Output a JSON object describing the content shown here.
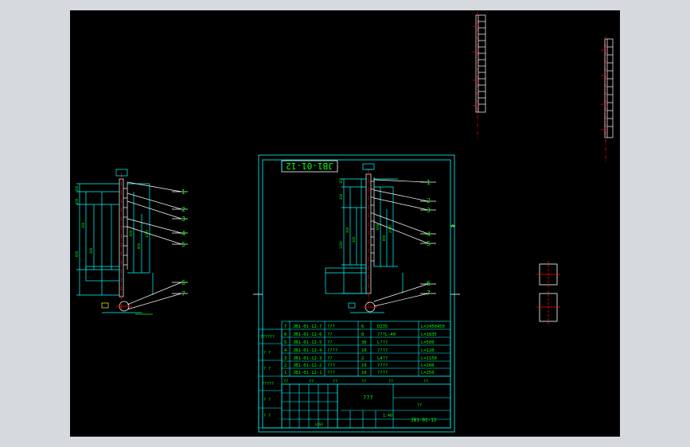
{
  "drawing": {
    "title_stamp": "JB1-01-12",
    "drawing_code": "JB1-01-12",
    "part_name": "???",
    "sheet_name": "??",
    "scale": "1:40",
    "company": "LOGO",
    "balloons_main": [
      "1",
      "2",
      "3",
      "4",
      "5",
      "6",
      "7"
    ],
    "balloons_left": [
      "1",
      "2",
      "3",
      "4",
      "5",
      "6",
      "7"
    ],
    "dims_main": [
      "160",
      "200",
      "300",
      "1200",
      "300",
      "600",
      "800",
      "2000"
    ],
    "dims_left": [
      "160",
      "200",
      "300",
      "600",
      "300",
      "600",
      "800",
      "1200"
    ],
    "side_labels": [
      "A",
      "B"
    ],
    "left_stamps": [
      "??????",
      "? ?",
      "? ?",
      "?????",
      "? ?",
      "? ?"
    ]
  },
  "bom": {
    "rows": [
      {
        "no": "7",
        "code": "JB1-01-12-7",
        "name": "???",
        "qty": "6",
        "spec": "DZ35",
        "note": "L=2450450"
      },
      {
        "no": "6",
        "code": "JB1-01-12-6",
        "name": "??",
        "qty": "8",
        "spec": "???L-40",
        "note": "L=1835"
      },
      {
        "no": "5",
        "code": "JB1-01-12-5",
        "name": "??",
        "qty": "36",
        "spec": "L???",
        "note": "L=500"
      },
      {
        "no": "4",
        "code": "JB1-01-12-4",
        "name": "????",
        "qty": "10",
        "spec": "????",
        "note": "L=120"
      },
      {
        "no": "3",
        "code": "JB1-01-12-3",
        "name": "??",
        "qty": "2",
        "spec": "L4??",
        "note": "L=1150"
      },
      {
        "no": "2",
        "code": "JB1-01-12-2",
        "name": "???",
        "qty": "10",
        "spec": "????",
        "note": "L=200"
      },
      {
        "no": "1",
        "code": "JB1-01-12-1",
        "name": "???",
        "qty": "10",
        "spec": "????",
        "note": "L=250"
      }
    ],
    "footer": [
      "??",
      "??",
      "??",
      "??",
      "??",
      "??"
    ]
  },
  "colors": {
    "background": "#000000",
    "frame": "#00ffff",
    "text": "#00ff00",
    "outline": "#ffffff",
    "centerline": "#ff0000",
    "highlight": "#ffff00"
  }
}
